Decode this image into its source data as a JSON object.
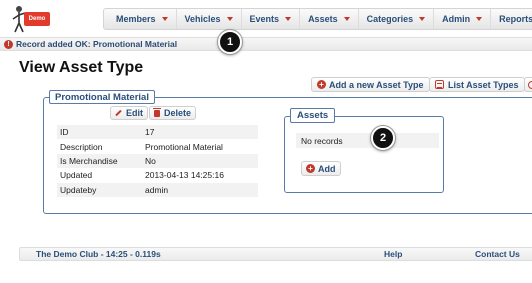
{
  "logo": {
    "badge_text": "Demo"
  },
  "nav": {
    "items": [
      {
        "label": "Members",
        "caret": true
      },
      {
        "label": "Vehicles",
        "caret": true
      },
      {
        "label": "Events",
        "caret": true
      },
      {
        "label": "Assets",
        "caret": true
      },
      {
        "label": "Categories",
        "caret": true
      },
      {
        "label": "Admin",
        "caret": true
      },
      {
        "label": "Reports",
        "caret": false
      }
    ]
  },
  "flash": {
    "message": "Record added OK: Promotional Material"
  },
  "callouts": {
    "first": "1",
    "second": "2"
  },
  "page": {
    "title": "View Asset Type"
  },
  "actions": {
    "add_new": "Add a new Asset Type",
    "list": "List Asset Types"
  },
  "record": {
    "legend": "Promotional Material",
    "edit_label": "Edit",
    "delete_label": "Delete",
    "fields": [
      {
        "key": "ID",
        "value": "17"
      },
      {
        "key": "Description",
        "value": "Promotional Material"
      },
      {
        "key": "Is Merchandise",
        "value": "No"
      },
      {
        "key": "Updated",
        "value": "2013-04-13 14:25:16"
      },
      {
        "key": "Updateby",
        "value": "admin"
      }
    ]
  },
  "assets": {
    "legend": "Assets",
    "empty_text": "No records",
    "add_label": "Add"
  },
  "footer": {
    "left": "The Demo Club - 14:25 - 0.119s",
    "help": "Help",
    "contact": "Contact Us"
  },
  "colors": {
    "accent_red": "#c0392b",
    "link_blue": "#2a4f79",
    "frame_blue": "#5a7aa8"
  }
}
